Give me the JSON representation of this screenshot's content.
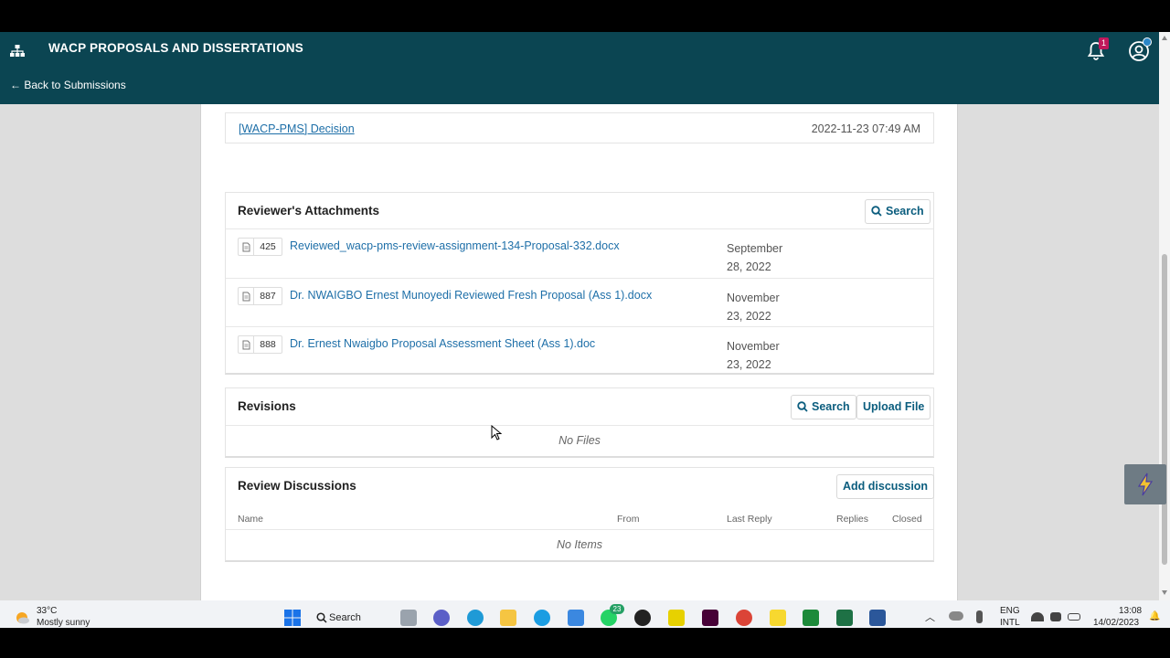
{
  "header": {
    "site_title": "WACP PROPOSALS AND DISSERTATIONS",
    "back_link": "← Back to Submissions",
    "notification_count": "1"
  },
  "decision": {
    "link": "[WACP-PMS] Decision",
    "date": "2022-11-23 07:49 AM"
  },
  "attachments": {
    "title": "Reviewer's Attachments",
    "search_label": "Search",
    "files": [
      {
        "id": "425",
        "name": "Reviewed_wacp-pms-review-assignment-134-Proposal-332.docx",
        "date_line1": "September",
        "date_line2": "28, 2022"
      },
      {
        "id": "887",
        "name": "Dr. NWAIGBO Ernest Munoyedi Reviewed Fresh Proposal (Ass 1).docx",
        "date_line1": "November",
        "date_line2": "23, 2022"
      },
      {
        "id": "888",
        "name": "Dr. Ernest Nwaigbo Proposal Assessment Sheet (Ass 1).doc",
        "date_line1": "November",
        "date_line2": "23, 2022"
      }
    ]
  },
  "revisions": {
    "title": "Revisions",
    "search_label": "Search",
    "upload_label": "Upload File",
    "empty": "No Files"
  },
  "discussions": {
    "title": "Review Discussions",
    "add_label": "Add discussion",
    "columns": [
      "Name",
      "From",
      "Last Reply",
      "Replies",
      "Closed"
    ],
    "empty": "No Items"
  },
  "taskbar": {
    "weather_temp": "33°C",
    "weather_desc": "Mostly sunny",
    "search_label": "Search",
    "whatsapp_badge": "23",
    "lang_line1": "ENG",
    "lang_line2": "INTL",
    "time": "13:08",
    "date": "14/02/2023"
  },
  "colors": {
    "header_bg": "#0b4552",
    "link": "#1e6fa8",
    "button_text": "#0b5d7e"
  }
}
